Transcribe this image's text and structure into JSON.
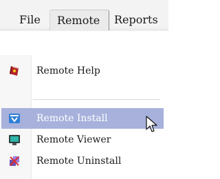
{
  "menubar": {
    "items": [
      {
        "label": "File"
      },
      {
        "label": "Remote"
      },
      {
        "label": "Reports"
      }
    ],
    "active": "Remote"
  },
  "dropdown": {
    "items": [
      {
        "label": "Remote Help",
        "icon": "help-book-icon"
      },
      {
        "label": "Remote Install",
        "icon": "install-icon",
        "highlighted": true
      },
      {
        "label": "Remote Viewer",
        "icon": "viewer-monitor-icon"
      },
      {
        "label": "Remote Uninstall",
        "icon": "uninstall-icon"
      }
    ]
  },
  "colors": {
    "highlight": "#a7b1dc",
    "menubar_bg": "#f3f3f3",
    "active_tab_bg": "#ebebeb"
  }
}
